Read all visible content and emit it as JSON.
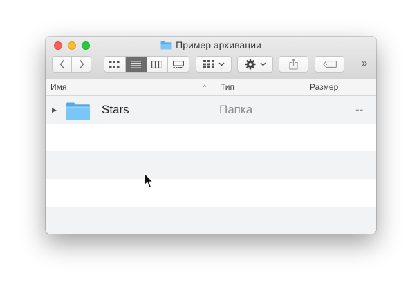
{
  "window": {
    "title": "Пример архивации",
    "folder_color": "#6bbdf3"
  },
  "toolbar": {
    "back_icon": "chevron-left-icon",
    "forward_icon": "chevron-right-icon",
    "view_modes": [
      "icon-view",
      "list-view",
      "column-view",
      "gallery-view"
    ],
    "active_view": "list-view",
    "arrange_icon": "arrange-grid-icon",
    "action_icon": "gear-icon",
    "share_icon": "share-icon",
    "tag_icon": "tag-icon",
    "overflow": "»"
  },
  "columns": {
    "name": "Имя",
    "type": "Тип",
    "size": "Размер",
    "sort_indicator": "^"
  },
  "rows": [
    {
      "name": "Stars",
      "type": "Папка",
      "size": "--"
    }
  ],
  "stripe_color": "#f2f3f4"
}
